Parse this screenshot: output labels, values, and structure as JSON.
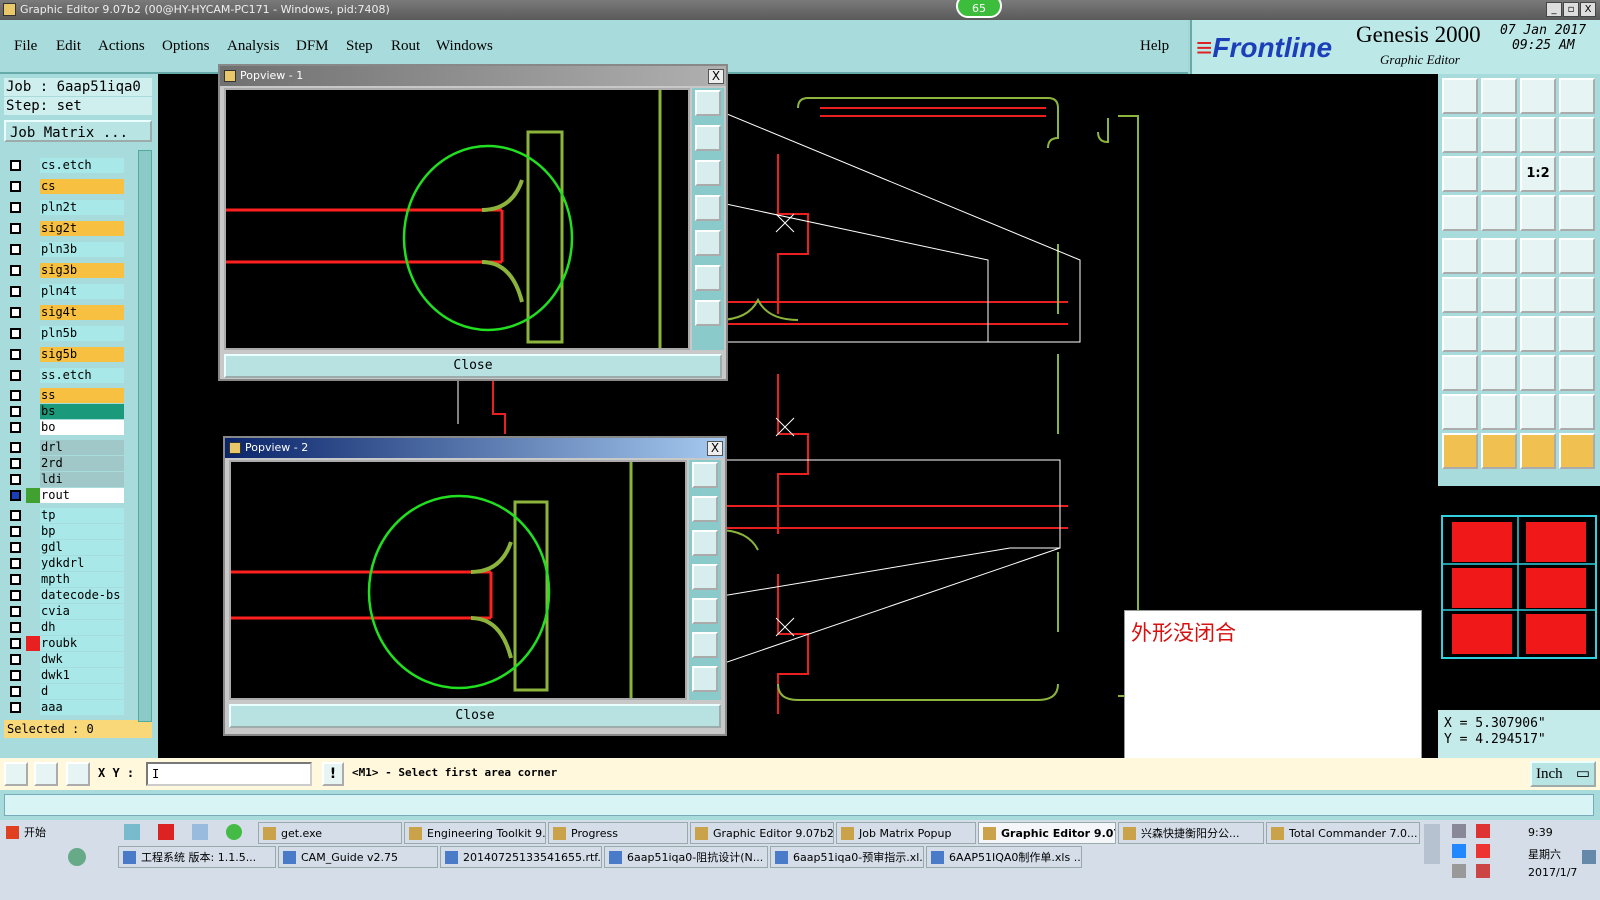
{
  "window": {
    "title": "Graphic Editor 9.07b2 (00@HY-HYCAM-PC171 - Windows, pid:7408)",
    "badge": "65",
    "controls": [
      "_",
      "▫",
      "X"
    ]
  },
  "menu": {
    "items": [
      "File",
      "Edit",
      "Actions",
      "Options",
      "Analysis",
      "DFM",
      "Step",
      "Rout",
      "Windows"
    ],
    "help": "Help"
  },
  "brand": {
    "logo": "Frontline",
    "product": "Genesis 2000",
    "subtitle": "Graphic Editor",
    "date": "07 Jan 2017",
    "time": "09:25 AM"
  },
  "job": {
    "job_line": "Job : 6aap51iqa0",
    "step_line": "Step: set",
    "matrix_button": "Job Matrix ...",
    "selected": "Selected : 0"
  },
  "layers": [
    {
      "name": "cs.etch",
      "bg": "#a8e8e8",
      "swatch": "#a8dcdc"
    },
    {
      "name": "cs",
      "bg": "#f8c040",
      "swatch": "#a8dcdc"
    },
    {
      "name": "pln2t",
      "bg": "#a8e8e8",
      "swatch": "#a8dcdc"
    },
    {
      "name": "sig2t",
      "bg": "#f8c040",
      "swatch": "#a8dcdc"
    },
    {
      "name": "pln3b",
      "bg": "#a8e8e8",
      "swatch": "#a8dcdc"
    },
    {
      "name": "sig3b",
      "bg": "#f8c040",
      "swatch": "#a8dcdc"
    },
    {
      "name": "pln4t",
      "bg": "#a8e8e8",
      "swatch": "#a8dcdc"
    },
    {
      "name": "sig4t",
      "bg": "#f8c040",
      "swatch": "#a8dcdc"
    },
    {
      "name": "pln5b",
      "bg": "#a8e8e8",
      "swatch": "#a8dcdc"
    },
    {
      "name": "sig5b",
      "bg": "#f8c040",
      "swatch": "#a8dcdc"
    },
    {
      "name": "ss.etch",
      "bg": "#a8e8e8",
      "swatch": "#a8dcdc"
    },
    {
      "name": "ss",
      "bg": "#f8c040",
      "swatch": "#a8dcdc"
    },
    {
      "name": "bs",
      "bg": "#1a9a7a",
      "swatch": "#a8dcdc"
    },
    {
      "name": "bo",
      "bg": "#ffffff",
      "swatch": "#a8dcdc"
    },
    {
      "name": "drl",
      "bg": "#a0c8c8",
      "swatch": "#a8dcdc"
    },
    {
      "name": "2rd",
      "bg": "#a0c8c8",
      "swatch": "#a8dcdc"
    },
    {
      "name": "ldi",
      "bg": "#a0c8c8",
      "swatch": "#a8dcdc"
    },
    {
      "name": "rout",
      "bg": "#ffffff",
      "swatch": "#40a030"
    },
    {
      "name": "tp",
      "bg": "#a8e8e8",
      "swatch": "#a8dcdc"
    },
    {
      "name": "bp",
      "bg": "#a8e8e8",
      "swatch": "#a8dcdc"
    },
    {
      "name": "gdl",
      "bg": "#a8e8e8",
      "swatch": "#a8dcdc"
    },
    {
      "name": "ydkdrl",
      "bg": "#a8e8e8",
      "swatch": "#a8dcdc"
    },
    {
      "name": "mpth",
      "bg": "#a8e8e8",
      "swatch": "#a8dcdc"
    },
    {
      "name": "datecode-bs",
      "bg": "#a8e8e8",
      "swatch": "#a8dcdc"
    },
    {
      "name": "cvia",
      "bg": "#a8e8e8",
      "swatch": "#a8dcdc"
    },
    {
      "name": "dh",
      "bg": "#a8e8e8",
      "swatch": "#a8dcdc"
    },
    {
      "name": "roubk",
      "bg": "#a8e8e8",
      "swatch": "#e82020"
    },
    {
      "name": "dwk",
      "bg": "#a8e8e8",
      "swatch": "#a8dcdc"
    },
    {
      "name": "dwk1",
      "bg": "#a8e8e8",
      "swatch": "#a8dcdc"
    },
    {
      "name": "d",
      "bg": "#a8e8e8",
      "swatch": "#a8dcdc"
    },
    {
      "name": "aaa",
      "bg": "#a8e8e8",
      "swatch": "#a8dcdc"
    }
  ],
  "popups": [
    {
      "title": "Popview - 1",
      "close_x": "X",
      "close_label": "Close"
    },
    {
      "title": "Popview - 2",
      "close_x": "X",
      "close_label": "Close"
    }
  ],
  "popup_tools": [
    "zoom-in-icon",
    "pan-up-icon",
    "pan-down-icon",
    "pan-left-icon",
    "pan-right-icon",
    "fit-icon",
    "center-icon"
  ],
  "right_tools": {
    "rows": [
      [
        "ghome-icon",
        "gdown-icon",
        "home-icon",
        "window-icon"
      ],
      [
        "left-icon",
        "right-icon",
        "zoom-back-icon",
        "zoom-s-icon"
      ],
      [
        "fit-vertical-icon",
        "fit-all-icon",
        "scale-icon",
        "help-icon"
      ],
      [
        "snap-icon",
        "grid-icon",
        "layers-red-icon",
        "layers-icon"
      ],
      [
        "pad-icon",
        "feature-red-icon",
        "ruler-icon",
        "dot-icon"
      ],
      [
        "nodes-icon",
        "cross-icon",
        "line-red-icon",
        "arc-red-icon"
      ],
      [
        "angle-icon",
        "diag-icon",
        "rotate-icon",
        "split-icon"
      ],
      [
        "move-icon",
        "minus-icon",
        "measure-icon",
        "copy-icon"
      ],
      [
        "triangle-icon",
        "arrow-up-icon",
        "a-red-icon",
        "a-cyan-icon"
      ],
      [
        "pointer-icon",
        "pointer-box-icon",
        "pointer-circle-icon",
        "pointer-multi-icon"
      ]
    ],
    "scale_label": "1:2"
  },
  "coords": {
    "x_line": "X = 5.307906\"",
    "y_line": "Y = 4.294517\""
  },
  "command": {
    "xy_label": "X Y :",
    "input_value": "I",
    "warn": "!",
    "message": "<M1> - Select first area corner",
    "units": "Inch"
  },
  "note": "外形没闭合",
  "taskbar": {
    "start": "开始",
    "row1": [
      "get.exe",
      "Engineering Toolkit 9....",
      "Progress",
      "Graphic Editor 9.07b2...",
      "Job Matrix Popup",
      "Graphic Editor 9.07...",
      "兴森快捷衡阳分公...",
      "Total Commander 7.0..."
    ],
    "row2": [
      "工程系统  版本: 1.1.5...",
      "CAM_Guide v2.75",
      "20140725133541655.rtf...",
      "6aap51iqa0-阻抗设计(N...",
      "6aap51iqa0-预审指示.xl...",
      "6AAP51IQA0制作单.xls ..."
    ],
    "clock": "9:39",
    "weekday": "星期六",
    "date": "2017/1/7"
  }
}
